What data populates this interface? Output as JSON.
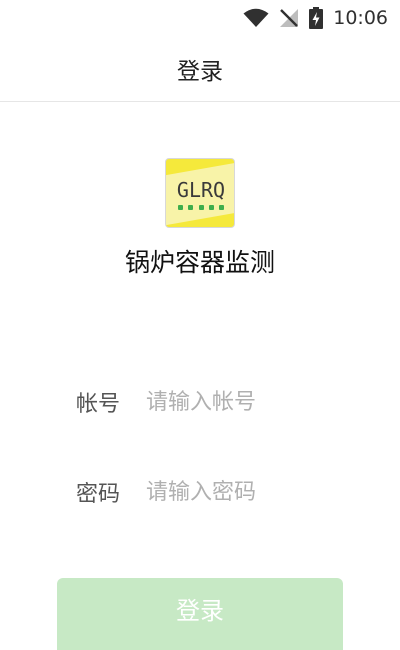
{
  "status_bar": {
    "time": "10:06",
    "icons": [
      "wifi-icon",
      "signal-icon",
      "battery-charging-icon"
    ]
  },
  "header": {
    "title": "登录"
  },
  "logo": {
    "text": "GLRQ",
    "colors": {
      "background": "#f5e93b",
      "band": "#f8f3a8",
      "dots": "#3fae4b"
    }
  },
  "app": {
    "name": "锅炉容器监测"
  },
  "form": {
    "account_label": "帐号",
    "account_placeholder": "请输入帐号",
    "account_value": "",
    "password_label": "密码",
    "password_placeholder": "请输入密码",
    "password_value": ""
  },
  "login_button": {
    "label": "登录",
    "color": "#c7e9c5"
  }
}
